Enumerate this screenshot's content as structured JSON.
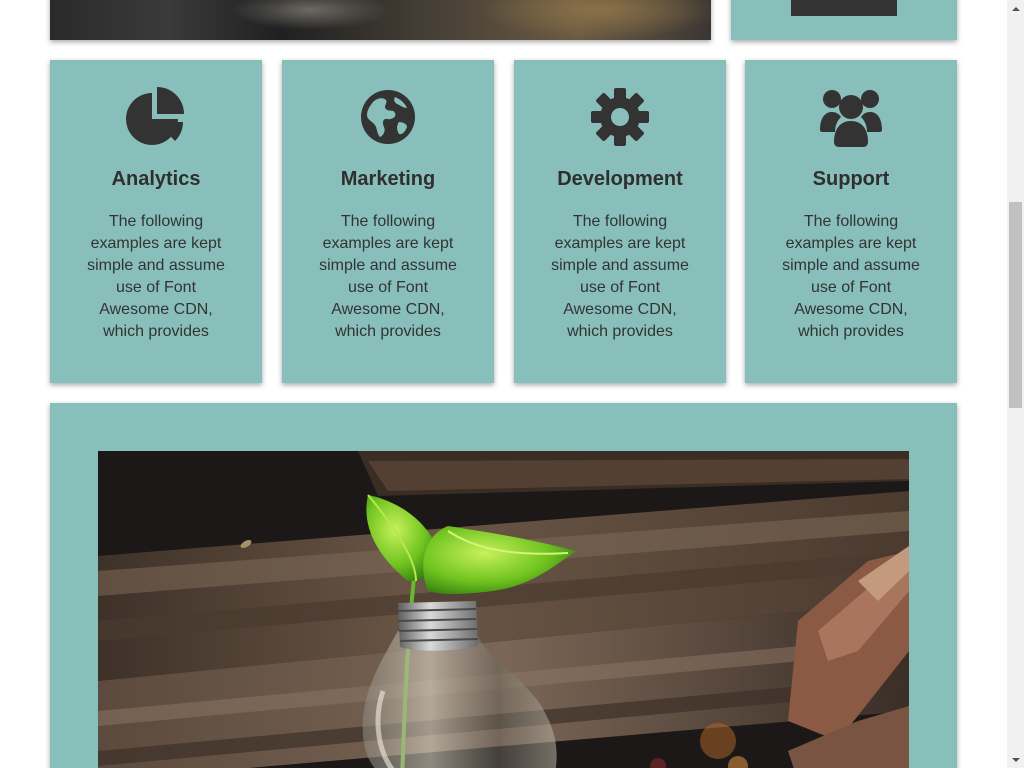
{
  "features": [
    {
      "icon": "pie-chart-icon",
      "title": "Analytics",
      "text": "The following examples are kept simple and assume use of Font Awesome CDN, which provides"
    },
    {
      "icon": "globe-icon",
      "title": "Marketing",
      "text": "The following examples are kept simple and assume use of Font Awesome CDN, which provides"
    },
    {
      "icon": "gear-icon",
      "title": "Development",
      "text": "The following examples are kept simple and assume use of Font Awesome CDN, which provides"
    },
    {
      "icon": "users-icon",
      "title": "Support",
      "text": "The following examples are kept simple and assume use of Font Awesome CDN, which provides"
    }
  ],
  "colors": {
    "card_background": "#88bfbb",
    "icon_color": "#333333",
    "text_color": "#333333"
  },
  "bottom_image": {
    "subject": "lightbulb-plant-photo"
  }
}
